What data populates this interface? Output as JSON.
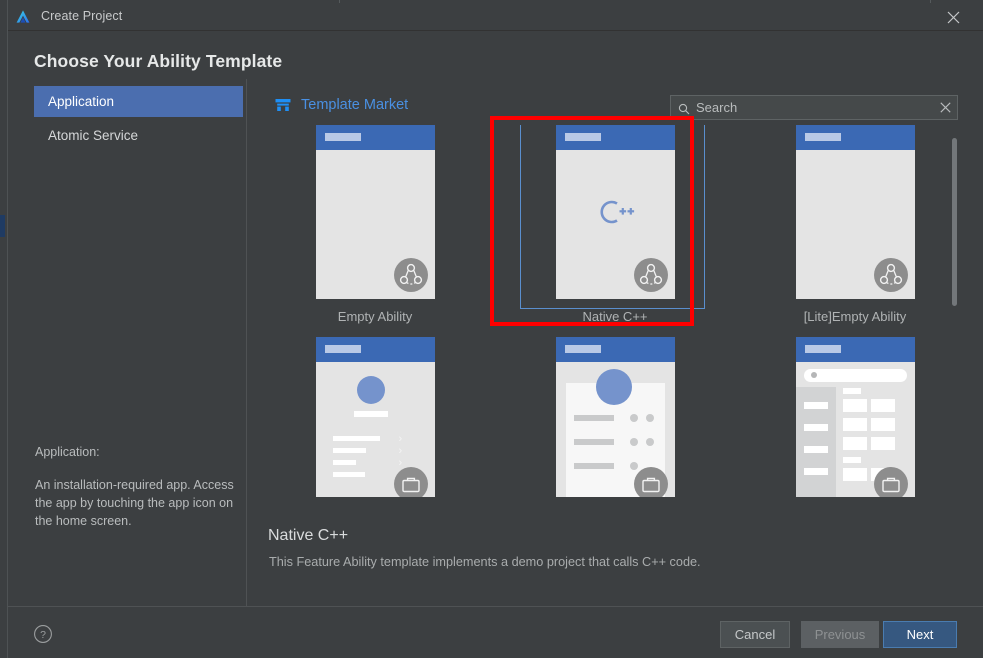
{
  "window": {
    "title": "Create Project",
    "logo_icon": "deveco-studio-logo-icon",
    "close_icon": "close-icon"
  },
  "heading": "Choose Your Ability Template",
  "categories": {
    "items": [
      {
        "label": "Application",
        "selected": true
      },
      {
        "label": "Atomic Service",
        "selected": false
      }
    ],
    "description_title": "Application:",
    "description_body": "An installation-required app. Access the app by touching the app icon on the home screen."
  },
  "market": {
    "label": "Template Market",
    "icon": "shop-icon"
  },
  "search": {
    "placeholder": "Search",
    "value": "",
    "icon": "search-icon",
    "clear_icon": "close-icon"
  },
  "templates": [
    {
      "label": "Empty Ability",
      "selected": false,
      "thumb": "empty",
      "badge": "share-nodes-icon"
    },
    {
      "label": "Native C++",
      "selected": true,
      "thumb": "cpp",
      "badge": "share-nodes-icon"
    },
    {
      "label": "[Lite]Empty Ability",
      "selected": false,
      "thumb": "empty",
      "badge": "share-nodes-icon"
    },
    {
      "label": "",
      "selected": false,
      "thumb": "list",
      "badge": "briefcase-icon"
    },
    {
      "label": "",
      "selected": false,
      "thumb": "profile",
      "badge": "briefcase-icon"
    },
    {
      "label": "",
      "selected": false,
      "thumb": "catalog",
      "badge": "briefcase-icon"
    }
  ],
  "detail": {
    "title": "Native C++",
    "description": "This Feature Ability template implements a demo project that calls C++ code."
  },
  "footer": {
    "help_icon": "help-circle-icon",
    "cancel": "Cancel",
    "previous": "Previous",
    "next": "Next"
  },
  "annotation": {
    "color": "#ff0000",
    "target": "Native C++"
  },
  "colors": {
    "dialog_background": "#3c3f41",
    "selection_blue": "#4b6eaf",
    "link_blue": "#4a90e2",
    "primary_button": "#365880",
    "card_header_blue": "#3b69b4",
    "annotation_red": "#ff0000"
  }
}
